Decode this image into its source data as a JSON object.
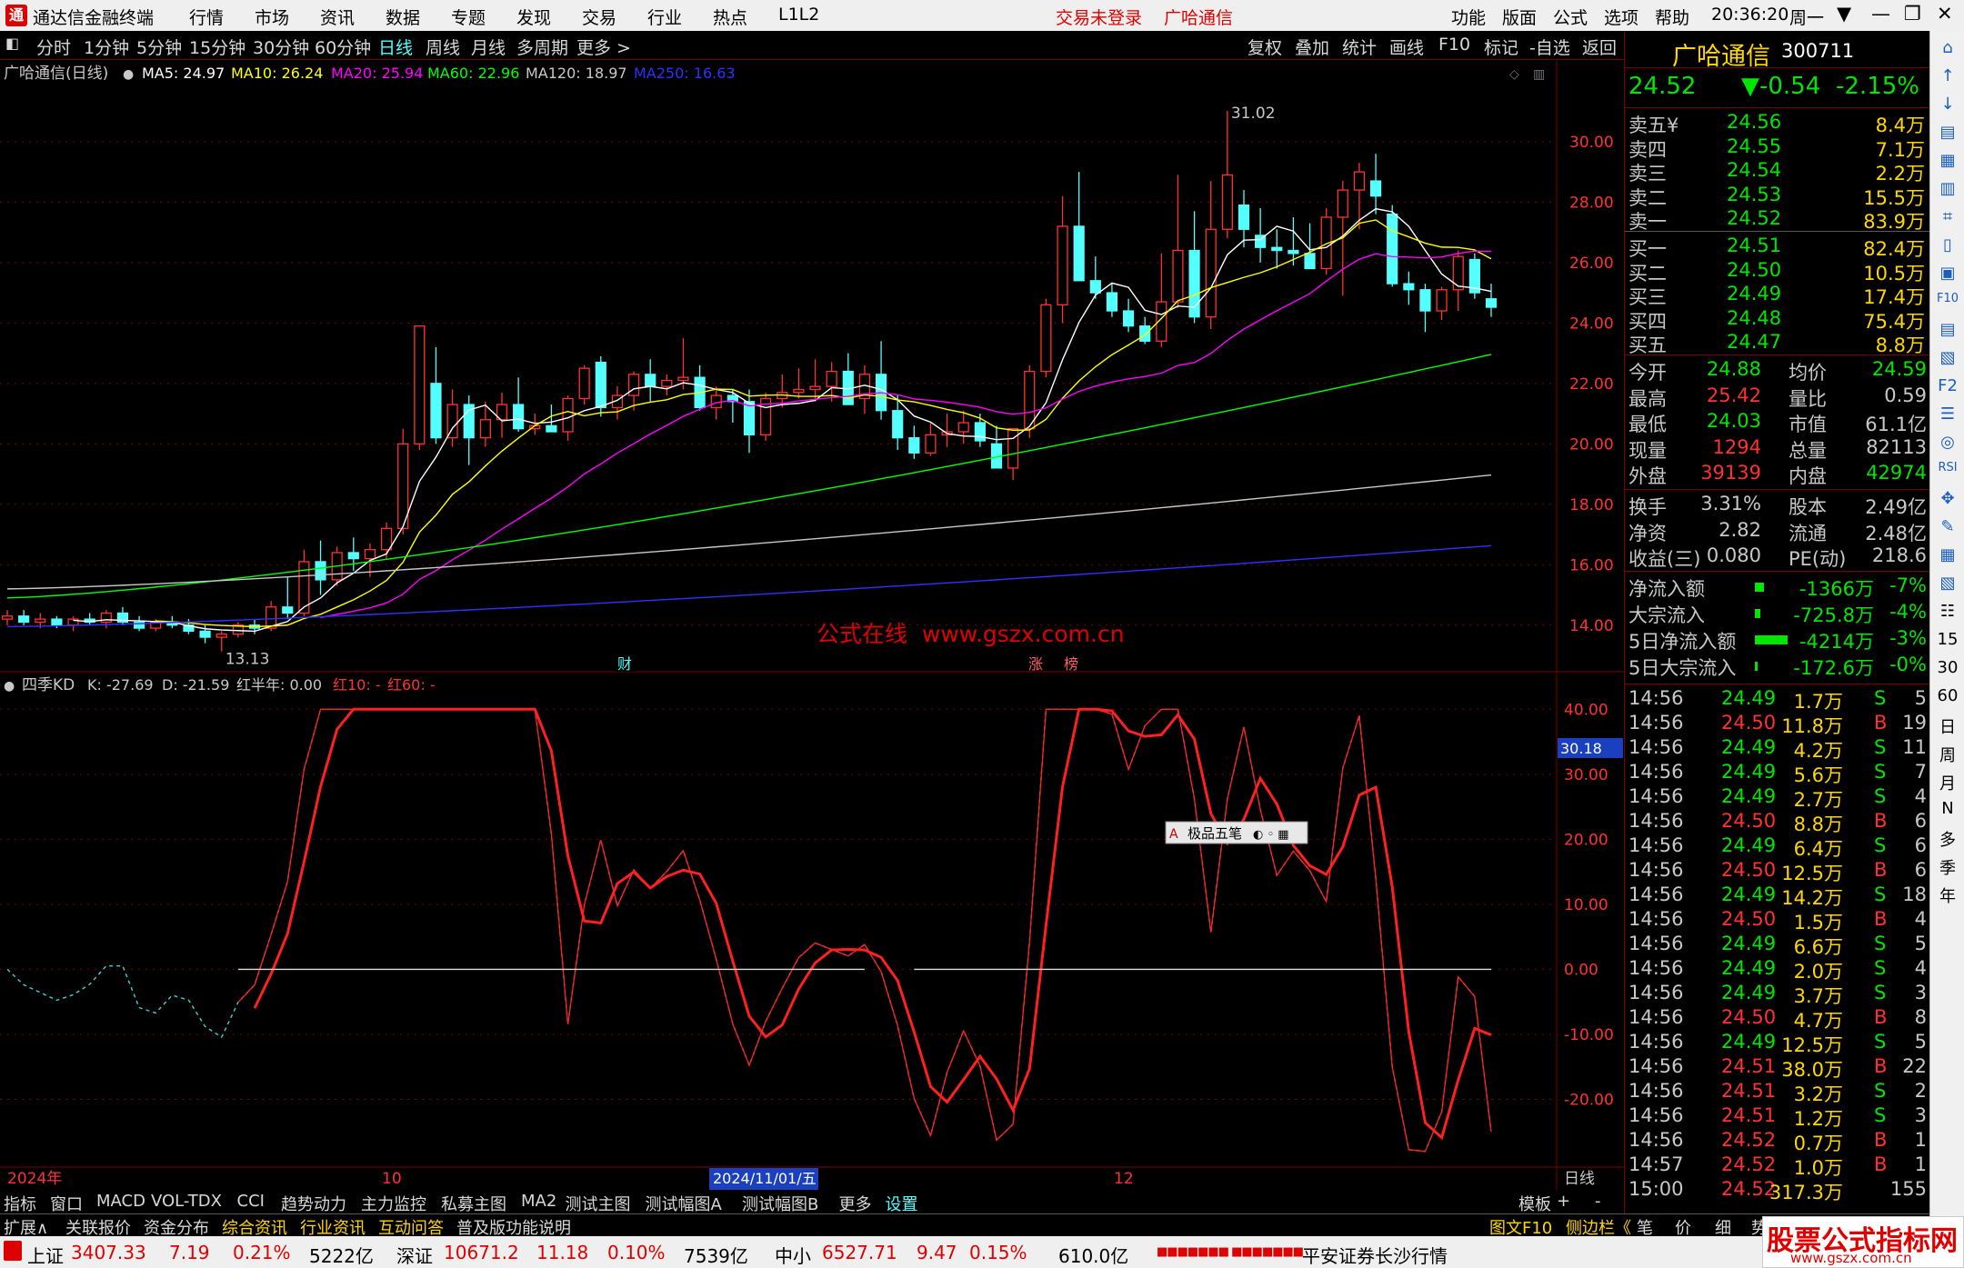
{
  "title_bar": {
    "logo": "通",
    "app_title": "通达信金融终端",
    "menus": [
      "行情",
      "市场",
      "资讯",
      "数据",
      "专题",
      "发现",
      "交易",
      "行业",
      "热点",
      "L1L2"
    ],
    "warning": "交易未登录",
    "stock": "广哈通信",
    "right_menus": [
      "功能",
      "版面",
      "公式",
      "选项",
      "帮助"
    ],
    "time": "20:36:20",
    "weekday": "周一",
    "window_buttons": [
      "▼",
      "—",
      "❐",
      "✕"
    ]
  },
  "toolbar": {
    "periods": [
      "分时",
      "1分钟",
      "5分钟",
      "15分钟",
      "30分钟",
      "60分钟",
      "日线",
      "周线",
      "月线",
      "多周期",
      "更多 >"
    ],
    "active_period": "日线",
    "right_tools": [
      "复权",
      "叠加",
      "统计",
      "画线",
      "F10",
      "标记",
      "-自选",
      "返回"
    ]
  },
  "chart_legend": {
    "name": "广哈通信(日线)",
    "ma5": "MA5: 24.97",
    "ma10": "MA10: 26.24",
    "ma20": "MA20: 25.94",
    "ma60": "MA60: 22.96",
    "ma120": "MA120: 18.97",
    "ma250": "MA250: 16.63"
  },
  "watermark_mid": "公式在线  www.gszx.com.cn",
  "indicator_legend": {
    "name": "四季KD",
    "k": "K: -27.69",
    "d": "D: -21.59",
    "hbn": "红半年: 0.00",
    "h10": "红10: -",
    "h60": "红60: -"
  },
  "indicator_value_label": "30.18",
  "widget_label": "极品五笔",
  "events": [
    "财",
    "涨",
    "榜"
  ],
  "annotations": {
    "high": "31.02",
    "low": "13.13"
  },
  "x_axis": {
    "labels": [
      "2024年",
      "10",
      "2024/11/01/五",
      "12"
    ],
    "period": "日线"
  },
  "chart_data": [
    {
      "type": "candlestick",
      "ylim": [
        13,
        31.5
      ],
      "yticks": [
        "30.00",
        "28.00",
        "26.00",
        "24.00",
        "22.00",
        "20.00",
        "18.00",
        "16.00",
        "14.00"
      ],
      "ohlc": [
        [
          14.2,
          14.5,
          14,
          14.3
        ],
        [
          14.3,
          14.5,
          14,
          14.1
        ],
        [
          14.1,
          14.4,
          13.9,
          14.2
        ],
        [
          14.2,
          14.3,
          13.9,
          14
        ],
        [
          14,
          14.3,
          13.8,
          14.2
        ],
        [
          14.2,
          14.4,
          14,
          14.1
        ],
        [
          14.1,
          14.5,
          13.9,
          14.4
        ],
        [
          14.4,
          14.6,
          14,
          14.1
        ],
        [
          14.1,
          14.3,
          13.8,
          13.9
        ],
        [
          13.9,
          14.2,
          13.8,
          14.1
        ],
        [
          14.1,
          14.3,
          13.9,
          14
        ],
        [
          14,
          14.2,
          13.7,
          13.8
        ],
        [
          13.8,
          14,
          13.4,
          13.6
        ],
        [
          13.6,
          13.8,
          13.13,
          13.7
        ],
        [
          13.7,
          14.1,
          13.6,
          14
        ],
        [
          14,
          14.2,
          13.7,
          13.9
        ],
        [
          13.9,
          14.8,
          13.8,
          14.6
        ],
        [
          14.6,
          15.6,
          14.2,
          14.4
        ],
        [
          14.4,
          16.5,
          14.3,
          16.1
        ],
        [
          16.1,
          16.8,
          15,
          15.5
        ],
        [
          15.5,
          16.6,
          15.3,
          16.4
        ],
        [
          16.4,
          16.9,
          15.8,
          16.2
        ],
        [
          16.2,
          16.7,
          15.6,
          16.5
        ],
        [
          16.5,
          17.4,
          16.2,
          17.2
        ],
        [
          17.2,
          20.5,
          17,
          20
        ],
        [
          20,
          23.9,
          19.8,
          23.9
        ],
        [
          22,
          23.2,
          20,
          20.2
        ],
        [
          20.2,
          21.8,
          19.9,
          21.3
        ],
        [
          21.3,
          21.6,
          19.3,
          20.2
        ],
        [
          20.2,
          21.4,
          19.9,
          20.8
        ],
        [
          20.8,
          21.7,
          20.2,
          21.3
        ],
        [
          21.3,
          22.2,
          20.4,
          20.5
        ],
        [
          20.5,
          21,
          20.3,
          20.6
        ],
        [
          20.6,
          21.3,
          20.4,
          20.4
        ],
        [
          20.4,
          21.6,
          20.1,
          21.5
        ],
        [
          21.5,
          22.6,
          21.3,
          22.5
        ],
        [
          22.7,
          22.9,
          20.9,
          21.2
        ],
        [
          21.2,
          21.9,
          20.8,
          21.6
        ],
        [
          21.6,
          22.4,
          21.1,
          22.3
        ],
        [
          22.3,
          22.8,
          21.4,
          21.9
        ],
        [
          21.9,
          22.3,
          21.6,
          22.1
        ],
        [
          22.1,
          23.5,
          21.8,
          22.2
        ],
        [
          22.2,
          22.6,
          21.1,
          21.2
        ],
        [
          21.2,
          21.9,
          20.8,
          21.6
        ],
        [
          21.6,
          21.8,
          20.7,
          21.4
        ],
        [
          21.4,
          21.8,
          19.7,
          20.3
        ],
        [
          20.3,
          21.7,
          20.1,
          21.5
        ],
        [
          21.5,
          22.3,
          21.2,
          21.7
        ],
        [
          21.7,
          22.5,
          21.5,
          21.8
        ],
        [
          21.8,
          22.8,
          21.4,
          21.9
        ],
        [
          21.9,
          22.7,
          21.4,
          22.4
        ],
        [
          22.4,
          23,
          21.4,
          21.3
        ],
        [
          21.5,
          22.6,
          21,
          22.3
        ],
        [
          22.3,
          23.4,
          20.8,
          21.1
        ],
        [
          21.1,
          21.6,
          19.8,
          20.2
        ],
        [
          20.2,
          20.6,
          19.5,
          19.7
        ],
        [
          19.7,
          20.7,
          19.6,
          20.3
        ],
        [
          20.3,
          21,
          19.9,
          20.4
        ],
        [
          20.4,
          21.1,
          20,
          20.7
        ],
        [
          20.7,
          21,
          19.9,
          20.1
        ],
        [
          20,
          20.6,
          19.3,
          19.2
        ],
        [
          19.2,
          20.5,
          18.8,
          20.5
        ],
        [
          20.5,
          22.6,
          20.2,
          22.4
        ],
        [
          22.4,
          24.8,
          22.2,
          24.6
        ],
        [
          24.6,
          28.2,
          24,
          27.2
        ],
        [
          27.2,
          29,
          26.8,
          25.4
        ],
        [
          25.4,
          26.2,
          24.8,
          25
        ],
        [
          25,
          25.3,
          24.2,
          24.4
        ],
        [
          24.4,
          24.8,
          23.7,
          23.9
        ],
        [
          23.9,
          24.2,
          23.3,
          23.4
        ],
        [
          23.4,
          26.3,
          23.2,
          24.7
        ],
        [
          24.7,
          28.9,
          24.5,
          26.4
        ],
        [
          26.4,
          27.7,
          24,
          24.2
        ],
        [
          24.2,
          28.7,
          23.8,
          27.1
        ],
        [
          27.1,
          31.02,
          26.8,
          28.9
        ],
        [
          27.9,
          28.4,
          26.5,
          27.1
        ],
        [
          26.9,
          27.8,
          26,
          26.5
        ],
        [
          26.5,
          27.1,
          25.8,
          26.4
        ],
        [
          26.4,
          27.5,
          25.9,
          26.3
        ],
        [
          26.3,
          27.3,
          25.8,
          25.8
        ],
        [
          25.8,
          27.8,
          25.6,
          27.5
        ],
        [
          27.5,
          28.7,
          24.9,
          28.4
        ],
        [
          28.4,
          29.3,
          27.1,
          29
        ],
        [
          28.7,
          29.6,
          27.6,
          28.2
        ],
        [
          27.6,
          27.9,
          25.2,
          25.3
        ],
        [
          25.3,
          25.7,
          24.6,
          25.1
        ],
        [
          25.1,
          25.3,
          23.7,
          24.4
        ],
        [
          24.4,
          25.2,
          24.1,
          25.1
        ],
        [
          25.1,
          26.4,
          24.4,
          26.2
        ],
        [
          26.1,
          26.3,
          24.8,
          25
        ],
        [
          24.8,
          25.3,
          24.2,
          24.52
        ]
      ],
      "ma": {
        "MA5": [
          14.16,
          14.18,
          14.15,
          14.13,
          14.09,
          14.04,
          13.98,
          13.92,
          13.94,
          14.08,
          14.4,
          14.72,
          15.12,
          15.46,
          15.84,
          16.2,
          16.9,
          17.9,
          19.2,
          20.2,
          20.9,
          21.2,
          21.2,
          20.9,
          20.85,
          20.8,
          20.9,
          21,
          21.2,
          21.3,
          21.2,
          21.3,
          21.4,
          21.6,
          21.7,
          21.8,
          21.9,
          22,
          22.1,
          22.1,
          22,
          21.85,
          21.7,
          21.6,
          21.55,
          21.4,
          21.3,
          21.2,
          21.1,
          20.9,
          20.8,
          20.6,
          20.5,
          20.4,
          20.4,
          20.3,
          20.1,
          20.05,
          20.2,
          20.9,
          21.8,
          23,
          24.3,
          25.2,
          25.4,
          25.2,
          24.7,
          24.3,
          24.2,
          24.3,
          24.7,
          25.2,
          26.4,
          27.4,
          27.8,
          27.8,
          27.4,
          26.9,
          26.7,
          26.9,
          27.3,
          27.6,
          27.6,
          27.2,
          26.9,
          26.4,
          25.7,
          25.1,
          24.97
        ]
      }
    },
    {
      "type": "line",
      "name": "四季KD",
      "ylim": [
        -30,
        42
      ],
      "yticks": [
        "40.00",
        "30.00",
        "20.00",
        "10.00",
        "0.00",
        "-10.00",
        "-20.00"
      ],
      "reference_level": 0
    }
  ],
  "quote": {
    "name": "广哈通信",
    "code": "300711",
    "price": "24.52",
    "change": "▼-0.54",
    "pct": "-2.15%",
    "asks": [
      {
        "label": "卖五",
        "flag": "¥",
        "price": "24.56",
        "vol": "8.4万"
      },
      {
        "label": "卖四",
        "price": "24.55",
        "vol": "7.1万"
      },
      {
        "label": "卖三",
        "price": "24.54",
        "vol": "2.2万"
      },
      {
        "label": "卖二",
        "price": "24.53",
        "vol": "15.5万"
      },
      {
        "label": "卖一",
        "price": "24.52",
        "vol": "83.9万"
      }
    ],
    "bids": [
      {
        "label": "买一",
        "price": "24.51",
        "vol": "82.4万"
      },
      {
        "label": "买二",
        "price": "24.50",
        "vol": "10.5万"
      },
      {
        "label": "买三",
        "price": "24.49",
        "vol": "17.4万"
      },
      {
        "label": "买四",
        "price": "24.48",
        "vol": "75.4万"
      },
      {
        "label": "买五",
        "price": "24.47",
        "vol": "8.8万"
      }
    ],
    "stats1": [
      {
        "l1": "今开",
        "v1": "24.88",
        "l2": "均价",
        "v2": "24.59"
      },
      {
        "l1": "最高",
        "v1": "25.42",
        "l2": "量比",
        "v2": "0.59"
      },
      {
        "l1": "最低",
        "v1": "24.03",
        "l2": "市值",
        "v2": "61.1亿"
      },
      {
        "l1": "现量",
        "v1": "1294",
        "l2": "总量",
        "v2": "82113"
      },
      {
        "l1": "外盘",
        "v1": "39139",
        "l2": "内盘",
        "v2": "42974"
      }
    ],
    "stats2": [
      {
        "l1": "换手",
        "v1": "3.31%",
        "l2": "股本",
        "v2": "2.49亿"
      },
      {
        "l1": "净资",
        "v1": "2.82",
        "l2": "流通",
        "v2": "2.48亿"
      },
      {
        "l1": "收益(三)",
        "v1": "0.080",
        "l2": "PE(动)",
        "v2": "218.6"
      }
    ],
    "flows": [
      {
        "label": "净流入额",
        "val": "-1366万",
        "pct": "-7%"
      },
      {
        "label": "大宗流入",
        "val": "-725.8万",
        "pct": "-4%"
      },
      {
        "label": "5日净流入额",
        "val": "-4214万",
        "pct": "-3%"
      },
      {
        "label": "5日大宗流入",
        "val": "-172.6万",
        "pct": "-0%"
      }
    ],
    "ticks": [
      [
        "14:56",
        "24.49",
        "1.7万",
        "S",
        "5"
      ],
      [
        "14:56",
        "24.50",
        "11.8万",
        "B",
        "19"
      ],
      [
        "14:56",
        "24.49",
        "4.2万",
        "S",
        "11"
      ],
      [
        "14:56",
        "24.49",
        "5.6万",
        "S",
        "7"
      ],
      [
        "14:56",
        "24.49",
        "2.7万",
        "S",
        "4"
      ],
      [
        "14:56",
        "24.50",
        "8.8万",
        "B",
        "6"
      ],
      [
        "14:56",
        "24.49",
        "6.4万",
        "S",
        "6"
      ],
      [
        "14:56",
        "24.50",
        "12.5万",
        "B",
        "6"
      ],
      [
        "14:56",
        "24.49",
        "14.2万",
        "S",
        "18"
      ],
      [
        "14:56",
        "24.50",
        "1.5万",
        "B",
        "4"
      ],
      [
        "14:56",
        "24.49",
        "6.6万",
        "S",
        "5"
      ],
      [
        "14:56",
        "24.49",
        "2.0万",
        "S",
        "4"
      ],
      [
        "14:56",
        "24.49",
        "3.7万",
        "S",
        "3"
      ],
      [
        "14:56",
        "24.50",
        "4.7万",
        "B",
        "8"
      ],
      [
        "14:56",
        "24.49",
        "12.5万",
        "S",
        "5"
      ],
      [
        "14:56",
        "24.51",
        "38.0万",
        "B",
        "22"
      ],
      [
        "14:56",
        "24.51",
        "3.2万",
        "S",
        "2"
      ],
      [
        "14:56",
        "24.51",
        "1.2万",
        "S",
        "3"
      ],
      [
        "14:56",
        "24.52",
        "0.7万",
        "B",
        "1"
      ],
      [
        "14:57",
        "24.52",
        "1.0万",
        "B",
        "1"
      ],
      [
        "15:00",
        "24.52",
        "317.3万",
        "",
        "155"
      ]
    ]
  },
  "right_toolbar": [
    "⌂",
    "↑",
    "↓",
    "▤",
    "▦",
    "▥",
    "⌗",
    "▯",
    "▣",
    "F10",
    "▤",
    "▧",
    "F2",
    "☰",
    "◎",
    "RSI",
    "✥",
    "✎",
    "▦",
    "▧",
    "☷",
    "15",
    "30",
    "60",
    "日",
    "周",
    "月",
    "N",
    "多",
    "季",
    "年"
  ],
  "bottom_tabs": [
    "指标",
    "窗口",
    "MACD",
    "VOL-TDX",
    "CCI",
    "趋势动力",
    "主力监控",
    "私募主图",
    "MA2",
    "测试主图",
    "测试幅图A",
    "测试幅图B",
    "更多",
    "设置",
    "模板",
    "+",
    "-"
  ],
  "info_tabs": [
    "扩展∧",
    "关联报价",
    "资金分布",
    "综合资讯",
    "行业资讯",
    "互动问答",
    "普及版功能说明"
  ],
  "info_right": [
    "图文F10",
    "侧边栏《",
    "笔",
    "价",
    "细",
    "势"
  ],
  "status": {
    "sh_label": "上证",
    "sh": "3407.33",
    "sh_chg": "7.19",
    "sh_pct": "0.21%",
    "sh_amt": "5222亿",
    "sz_label": "深证",
    "sz": "10671.2",
    "sz_chg": "11.18",
    "sz_pct": "0.10%",
    "sz_amt": "7539亿",
    "zx_label": "中小",
    "zx": "6527.71",
    "zx_chg": "9.47",
    "zx_pct": "0.15%",
    "zx_amt": "610.0亿",
    "broker": "平安证券长沙行情",
    "wm_title": "股票公式指标网",
    "wm_url": "www.gszx.com.cn"
  },
  "colors": {
    "up": "#ff3232",
    "down": "#54ffff",
    "ma5": "#ffffff",
    "ma10": "#ffff00",
    "ma20": "#ff00ff",
    "ma60": "#00ff00",
    "ma120": "#c8c8c8",
    "ma250": "#3030ff",
    "green": "#00e600",
    "gold": "#ffd700"
  }
}
